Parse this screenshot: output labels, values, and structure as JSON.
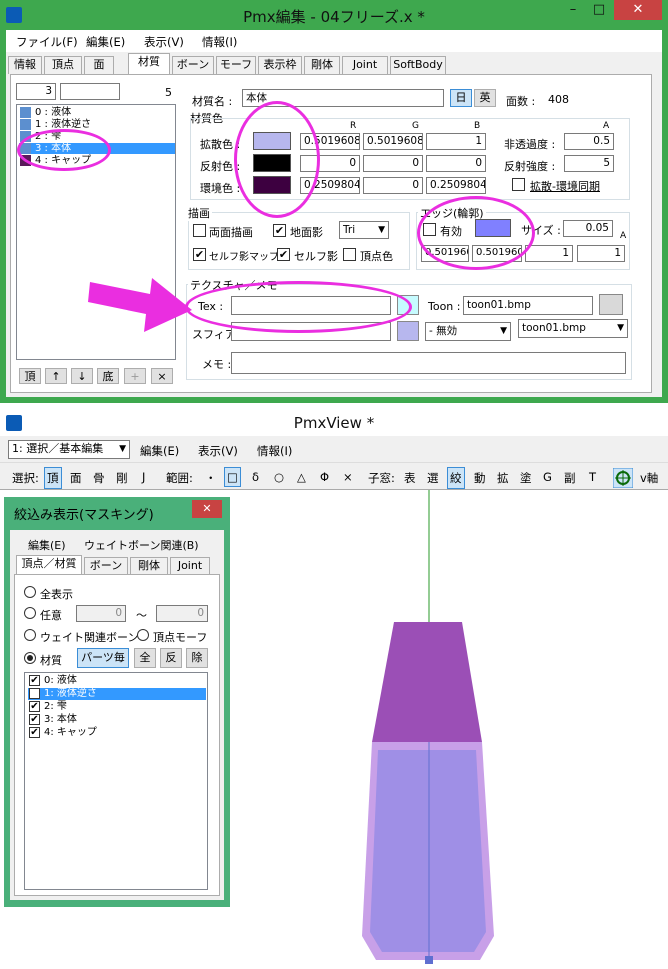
{
  "editor": {
    "title": "Pmx編集 - 04フリーズ.x *",
    "controls": {
      "minimize": "–",
      "maximize": "□",
      "close": "✕"
    },
    "menu": [
      "ファイル(F)",
      "編集(E)",
      "表示(V)",
      "情報(I)"
    ],
    "tabs": [
      "情報",
      "頂点",
      "面",
      "材質",
      "ボーン",
      "モーフ",
      "表示枠",
      "剛体",
      "Joint",
      "SoftBody"
    ],
    "active_tab": "材質",
    "index_value": "3",
    "index_count": "5",
    "materials": [
      {
        "label": "0 : 液体",
        "color": "#5c8fcf"
      },
      {
        "label": "1 : 液体逆さ",
        "color": "#5c8fcf"
      },
      {
        "label": "2 : 雫",
        "color": "#5c8fcf"
      },
      {
        "label": "3 : 本体",
        "color": "#5c8fcf"
      },
      {
        "label": "4 : キャップ",
        "color": "#5a1a5a"
      }
    ],
    "selected_material": 3,
    "list_buttons": [
      "頂",
      "↑",
      "↓",
      "底",
      "+",
      "×"
    ],
    "material_name_label": "材質名 :",
    "material_name": "本体",
    "lang_buttons": [
      "日",
      "英"
    ],
    "face_count_label": "面数 :",
    "face_count": "408",
    "material_color_label": "材質色",
    "col_headers": [
      "R",
      "G",
      "B",
      "A"
    ],
    "diffuse": {
      "label": "拡散色 :",
      "r": "0.5019608",
      "g": "0.5019608",
      "b": "1",
      "color": "#b7b7ee"
    },
    "specular": {
      "label": "反射色 :",
      "r": "0",
      "g": "0",
      "b": "0",
      "color": "#000000"
    },
    "ambient": {
      "label": "環境色 :",
      "r": "0.2509804",
      "g": "0",
      "b": "0.2509804",
      "color": "#3d0040"
    },
    "alpha_label": "非透過度 :",
    "alpha": "0.5",
    "spec_power_label": "反射強度 :",
    "spec_power": "5",
    "sync_label": "拡散-環境同期",
    "draw_group": "描画",
    "double_sided": "両面描画",
    "ground_shadow": "地面影",
    "tri_value": "Tri",
    "self_shadow_map": "セルフ影マップ",
    "self_shadow": "セルフ影",
    "vertex_color": "頂点色",
    "edge_group": "エッジ(輪郭)",
    "edge_enabled": "有効",
    "edge_color": "#8080ff",
    "edge_size_label": "サイズ :",
    "edge_size": "0.05",
    "edge_a_label": "A",
    "edge_rgba": [
      "0.501960",
      "0.501960",
      "1",
      "1"
    ],
    "texture_group": "テクスチャ／メモ",
    "tex_label": "Tex :",
    "tex_value": "",
    "toon_label": "Toon :",
    "toon_value": "toon01.bmp",
    "sphere_label": "スフィア :",
    "sphere_mode": "- 無効",
    "toon_select": "toon01.bmp",
    "memo_label": "メモ :",
    "memo_value": "",
    "accent": "#ea2ee0"
  },
  "viewer": {
    "title": "PmxView *",
    "mode_select": "1: 選択／基本編集",
    "menu": [
      "編集(E)",
      "表示(V)",
      "情報(I)"
    ],
    "toolbar_select_label": "選択:",
    "toolbar_select": [
      "頂",
      "面",
      "骨",
      "剛",
      "J"
    ],
    "toolbar_range_label": "範囲:",
    "toolbar_range": [
      "・",
      "□",
      "δ",
      "○",
      "△",
      "Φ",
      "×"
    ],
    "toolbar_sub_label": "子窓:",
    "toolbar_sub": [
      "表",
      "選",
      "絞",
      "動",
      "拡",
      "塗",
      "G",
      "副",
      "T"
    ],
    "toolbar_extra": "v軸"
  },
  "mask_dialog": {
    "title": "絞込み表示(マスキング)",
    "menu": [
      "編集(E)",
      "ウェイトボーン関連(B)"
    ],
    "tabs": [
      "頂点／材質",
      "ボーン",
      "剛体",
      "Joint"
    ],
    "opt_all": "全表示",
    "opt_any": "任意",
    "any_from": "0",
    "tilde": "～",
    "any_to": "0",
    "opt_weight": "ウェイト関連ボーン",
    "opt_vmorph": "頂点モーフ",
    "opt_material": "材質",
    "btn_parts": "パーツ毎",
    "btn_all": "全",
    "btn_invert": "反",
    "btn_remove": "除",
    "items": [
      {
        "label": "0: 液体",
        "checked": true
      },
      {
        "label": "1: 液体逆さ",
        "checked": false
      },
      {
        "label": "2: 雫",
        "checked": true
      },
      {
        "label": "3: 本体",
        "checked": true
      },
      {
        "label": "4: キャップ",
        "checked": true
      }
    ],
    "close_glyph": "✕",
    "check_glyph": "✔"
  },
  "model": {
    "cap_color": "#9b4fb6",
    "body_color": "#9f8fe6",
    "body_edge": "#c8a0e8",
    "axis_color": "#2a9a2a"
  }
}
